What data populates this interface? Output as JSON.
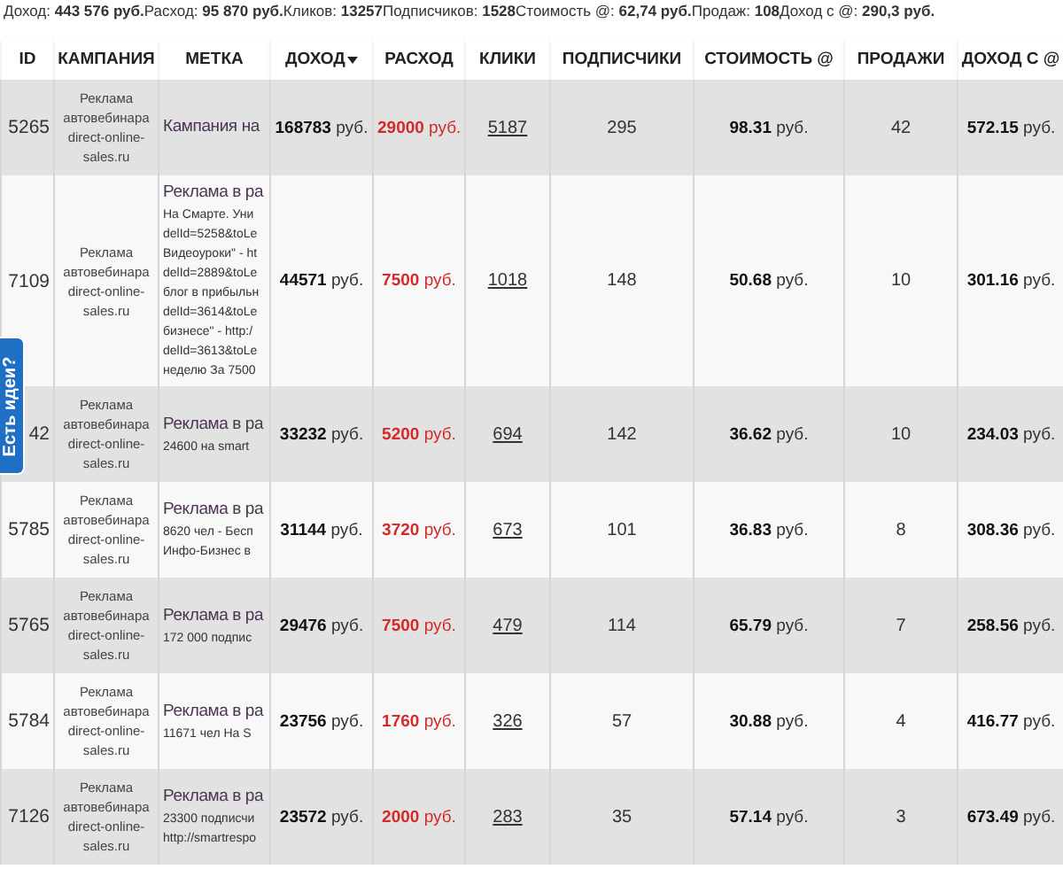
{
  "summary": "Доход: **443 576 руб.**Расход: **95 870 руб.**Кликов: **13257**Подписчиков: **1528**Стоимость @: **62,74 руб.**Продаж: **108**Доход с @: **290,3 руб.**",
  "columns": [
    {
      "label": "ID",
      "sorted": false
    },
    {
      "label": "КАМПАНИЯ",
      "sorted": false
    },
    {
      "label": "МЕТКА",
      "sorted": false
    },
    {
      "label": "ДОХОД",
      "sorted": true
    },
    {
      "label": "РАСХОД",
      "sorted": false
    },
    {
      "label": "КЛИКИ",
      "sorted": false
    },
    {
      "label": "ПОДПИСЧИКИ",
      "sorted": false
    },
    {
      "label": "СТОИМОСТЬ @",
      "sorted": false
    },
    {
      "label": "ПРОДАЖИ",
      "sorted": false
    },
    {
      "label": "ДОХОД С @",
      "sorted": false
    }
  ],
  "rows": [
    {
      "id": "5265",
      "campaign": "Реклама автовебинара direct-online-sales.ru",
      "tag_title": "Кампания на",
      "tag_lines": [],
      "income": "**168783** руб.",
      "expense": "**29000** руб.",
      "clicks": "5187",
      "subscribers": "295",
      "cost": "**98.31** руб.",
      "sales": "42",
      "income_per_sub": "**572.15** руб."
    },
    {
      "id": "7109",
      "campaign": "Реклама автовебинара direct-online-sales.ru",
      "tag_title": "Реклама в ра",
      "tag_lines": [
        "На Смарте. Уни",
        "delId=5258&toLe",
        "Видеоуроки\" - ht",
        "delId=2889&toLe",
        "блог в прибыльн",
        "delId=3614&toLe",
        "бизнесе\" - http:/",
        "delId=3613&toLe",
        "неделю За 7500"
      ],
      "income": "**44571** руб.",
      "expense": "**7500** руб.",
      "clicks": "1018",
      "subscribers": "148",
      "cost": "**50.68** руб.",
      "sales": "10",
      "income_per_sub": "**301.16** руб."
    },
    {
      "id": "42",
      "campaign": "Реклама автовебинара direct-online-sales.ru",
      "tag_title": "Реклама в ра",
      "tag_lines": [
        "24600 на smart"
      ],
      "income": "**33232** руб.",
      "expense": "**5200** руб.",
      "clicks": "694",
      "subscribers": "142",
      "cost": "**36.62** руб.",
      "sales": "10",
      "income_per_sub": "**234.03** руб."
    },
    {
      "id": "5785",
      "campaign": "Реклама автовебинара direct-online-sales.ru",
      "tag_title": "Реклама в ра",
      "tag_lines": [
        "8620 чел - Бесп",
        "Инфо-Бизнес в"
      ],
      "income": "**31144** руб.",
      "expense": "**3720** руб.",
      "clicks": "673",
      "subscribers": "101",
      "cost": "**36.83** руб.",
      "sales": "8",
      "income_per_sub": "**308.36** руб."
    },
    {
      "id": "5765",
      "campaign": "Реклама автовебинара direct-online-sales.ru",
      "tag_title": "Реклама в ра",
      "tag_lines": [
        "172 000 подпис"
      ],
      "income": "**29476** руб.",
      "expense": "**7500** руб.",
      "clicks": "479",
      "subscribers": "114",
      "cost": "**65.79** руб.",
      "sales": "7",
      "income_per_sub": "**258.56** руб."
    },
    {
      "id": "5784",
      "campaign": "Реклама автовебинара direct-online-sales.ru",
      "tag_title": "Реклама в ра",
      "tag_lines": [
        "11671 чел На S"
      ],
      "income": "**23756** руб.",
      "expense": "**1760** руб.",
      "clicks": "326",
      "subscribers": "57",
      "cost": "**30.88** руб.",
      "sales": "4",
      "income_per_sub": "**416.77** руб."
    },
    {
      "id": "7126",
      "campaign": "Реклама автовебинара direct-online-sales.ru",
      "tag_title": "Реклама в ра",
      "tag_lines": [
        "23300 подписчи",
        "http://smartrespo"
      ],
      "income": "**23572** руб.",
      "expense": "**2000** руб.",
      "clicks": "283",
      "subscribers": "35",
      "cost": "**57.14** руб.",
      "sales": "3",
      "income_per_sub": "**673.49** руб."
    }
  ],
  "feedback_tab": {
    "label": "Есть идеи?"
  }
}
